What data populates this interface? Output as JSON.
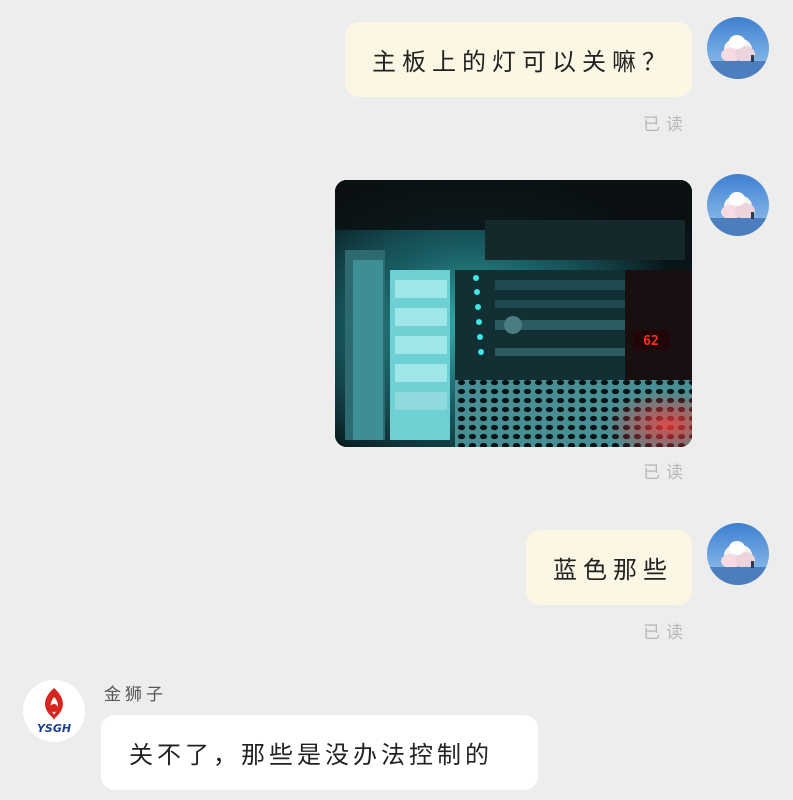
{
  "messages": [
    {
      "text": "主板上的灯可以关嘛？",
      "status": "已读"
    },
    {
      "status": "已读"
    },
    {
      "text": "蓝色那些",
      "status": "已读"
    }
  ],
  "reply": {
    "sender": "金狮子",
    "text": "关不了，那些是没办法控制的",
    "avatar_logo_text": "YSGH"
  },
  "photo": {
    "temperature_display": "62"
  },
  "colors": {
    "background": "#ededed",
    "outgoing_bubble": "#fcf7e4",
    "incoming_bubble": "#ffffff",
    "read_status": "#b8b8b8",
    "led_cyan": "#3fe6e6",
    "led_red": "#ff2a2a",
    "logo_red": "#d7261e",
    "logo_blue": "#1d3f93"
  }
}
